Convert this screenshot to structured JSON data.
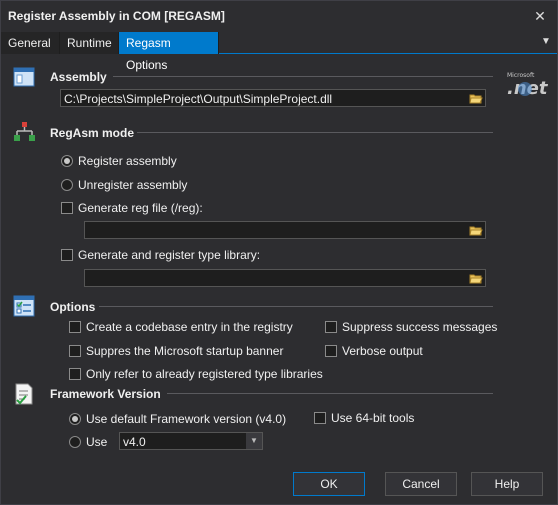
{
  "window": {
    "title": "Register Assembly in COM [REGASM]",
    "close_icon": "close-icon"
  },
  "tabs": [
    {
      "label": "General",
      "active": false
    },
    {
      "label": "Runtime",
      "active": false
    },
    {
      "label": "Regasm Options",
      "active": true
    }
  ],
  "assembly": {
    "title": "Assembly",
    "path": "C:\\Projects\\SimpleProject\\Output\\SimpleProject.dll",
    "logo_text": "Microsoft .net"
  },
  "regasm_mode": {
    "title": "RegAsm mode",
    "register_label": "Register assembly",
    "register_selected": true,
    "unregister_label": "Unregister assembly",
    "genreg_label": "Generate reg file (/reg):",
    "genreg_checked": false,
    "genreg_path": "",
    "typelib_label": "Generate and register type library:",
    "typelib_checked": false,
    "typelib_path": ""
  },
  "options": {
    "title": "Options",
    "codebase_label": "Create a codebase entry in the registry",
    "suppress_success_label": "Suppress success messages",
    "suppress_banner_label": "Suppres the Microsoft startup banner",
    "verbose_label": "Verbose output",
    "registered_typelibs_label": "Only refer to already registered type libraries"
  },
  "framework": {
    "title": "Framework Version",
    "default_label": "Use default Framework version (v4.0)",
    "default_selected": true,
    "use64_label": "Use 64-bit tools",
    "use_label": "Use",
    "version_value": "v4.0"
  },
  "footer": {
    "ok_label": "OK",
    "cancel_label": "Cancel",
    "help_label": "Help"
  },
  "colors": {
    "accent": "#007acc",
    "background": "#2d2d30",
    "input_bg": "#1e1e1e"
  }
}
